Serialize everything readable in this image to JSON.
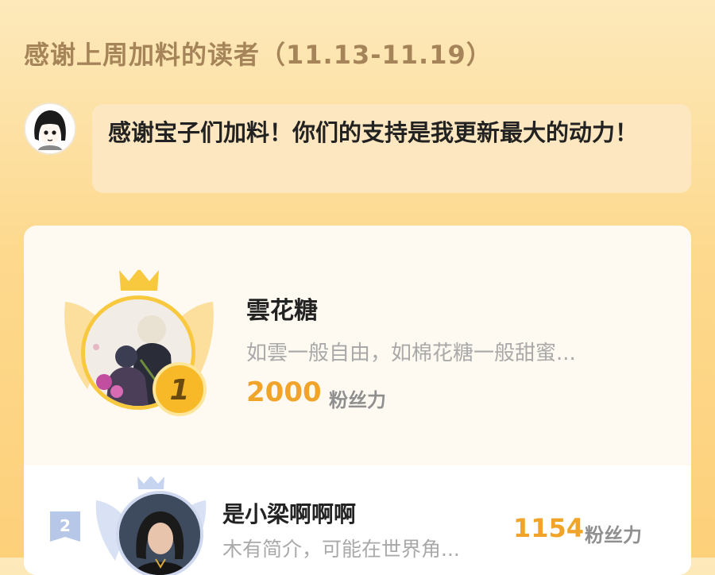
{
  "header": {
    "title": "感谢上周加料的读者（11.13-11.19）"
  },
  "author_message": {
    "text": "感谢宝子们加料！你们的支持是我更新最大的动力！"
  },
  "ranking": [
    {
      "rank": "1",
      "name": "雲花糖",
      "intro": "如雲一般自由，如棉花糖一般甜蜜...",
      "score": "2000",
      "unit": "粉丝力"
    },
    {
      "rank": "2",
      "name": "是小梁啊啊啊",
      "intro": "木有简介，可能在世界角...",
      "score": "1154",
      "unit": "粉丝力"
    }
  ],
  "colors": {
    "accent": "#f0a42a",
    "gold": "#f8c93f",
    "title": "#a6845a",
    "silver": "#b7c7e8"
  }
}
